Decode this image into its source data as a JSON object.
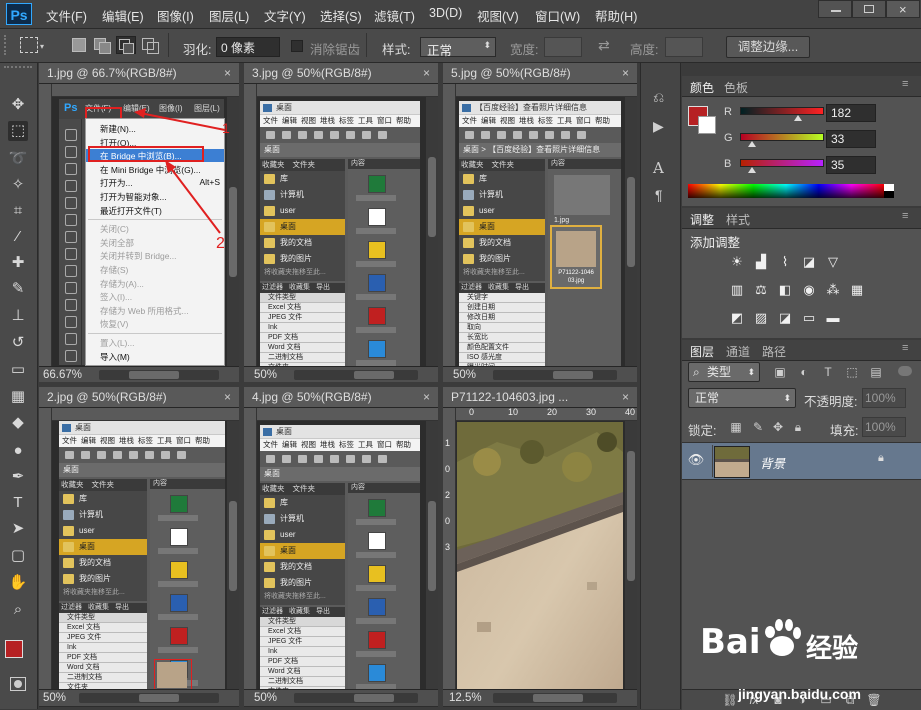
{
  "app": {
    "logo": "Ps"
  },
  "menu": [
    "文件(F)",
    "编辑(E)",
    "图像(I)",
    "图层(L)",
    "文字(Y)",
    "选择(S)",
    "滤镜(T)",
    "3D(D)",
    "视图(V)",
    "窗口(W)",
    "帮助(H)"
  ],
  "options": {
    "feather_label": "羽化:",
    "feather_value": "0 像素",
    "antialias_label": "消除锯齿",
    "style_label": "样式:",
    "style_value": "正常",
    "width_label": "宽度:",
    "height_label": "高度:",
    "refine_edge": "调整边缘..."
  },
  "docs": [
    {
      "title": "1.jpg @ 66.7%(RGB/8#)",
      "zoom": "66.67%"
    },
    {
      "title": "3.jpg @ 50%(RGB/8#)",
      "zoom": "50%"
    },
    {
      "title": "5.jpg @ 50%(RGB/8#)",
      "zoom": "50%"
    },
    {
      "title": "2.jpg @ 50%(RGB/8#)",
      "zoom": "50%"
    },
    {
      "title": "4.jpg @ 50%(RGB/8#)",
      "zoom": "50%"
    },
    {
      "title": "P71122-104603.jpg ...",
      "zoom": "12.5%"
    }
  ],
  "close_glyph": "×",
  "doc6_ruler": [
    "0",
    "10",
    "20",
    "30",
    "40"
  ],
  "doc6_vruler": [
    "1",
    "0",
    "2",
    "0",
    "3"
  ],
  "doc1": {
    "ps": "Ps",
    "mini_menu": [
      "文件(F)",
      "编辑(E)",
      "图像(I)",
      "图层(L)"
    ],
    "dropdown": [
      {
        "label": "新建(N)...",
        "dis": false
      },
      {
        "label": "打开(O)...",
        "dis": false
      },
      {
        "label": "在 Bridge 中浏览(B)...",
        "dis": false,
        "hl": true
      },
      {
        "label": "在 Mini Bridge 中浏览(G)...",
        "dis": false
      },
      {
        "label": "打开为...",
        "dis": false,
        "short": "Alt+S"
      },
      {
        "label": "打开为智能对象...",
        "dis": false
      },
      {
        "label": "最近打开文件(T)",
        "dis": false
      },
      {
        "label": "关闭(C)",
        "dis": true
      },
      {
        "label": "关闭全部",
        "dis": true
      },
      {
        "label": "关闭并转到 Bridge...",
        "dis": true
      },
      {
        "label": "存储(S)",
        "dis": true
      },
      {
        "label": "存储为(A)...",
        "dis": true
      },
      {
        "label": "签入(I)...",
        "dis": true
      },
      {
        "label": "存储为 Web 所用格式...",
        "dis": true
      },
      {
        "label": "恢复(V)",
        "dis": true
      },
      {
        "label": "置入(L)...",
        "dis": true
      },
      {
        "label": "导入(M)",
        "dis": false
      }
    ],
    "annot1": "1",
    "annot2": "2"
  },
  "bridge": {
    "title": "桌面",
    "title5": "【百度经验】查看照片详细信息",
    "menu": [
      "文件",
      "编辑",
      "视图",
      "堆栈",
      "标签",
      "工具",
      "窗口",
      "帮助"
    ],
    "path": "桌面",
    "path5": "桌面 > 【百度经验】查看照片详细信息",
    "fav_tabs": [
      "收藏夹",
      "文件夹"
    ],
    "fav": [
      "库",
      "计算机",
      "user",
      "桌面",
      "我的文档",
      "我的图片"
    ],
    "fav_hint": "将收藏夹拖移至此...",
    "filter_tabs": [
      "过滤器",
      "收藏集",
      "导出"
    ],
    "meta_head": "文件类型",
    "meta": [
      {
        "k": "Excel 文档",
        "v": "6"
      },
      {
        "k": "JPEG 文件",
        "v": "6"
      },
      {
        "k": "Ink",
        "v": "18"
      },
      {
        "k": "PDF 文档",
        "v": "4"
      },
      {
        "k": "Word 文档",
        "v": "6"
      },
      {
        "k": "二进制文档",
        "v": "1"
      },
      {
        "k": "文件夹",
        "v": "21"
      }
    ],
    "meta_foot": "关键字",
    "content_tab": "内容",
    "meta5": [
      "关键字",
      "创建日期",
      "修改日期",
      "取向",
      "长宽比",
      "颜色配置文件",
      "ISO 感光度",
      "曝光时间",
      "光圈值"
    ],
    "thumb5": "P71122-1046 03.jpg",
    "thumb5_name": "1.jpg",
    "thumb2_name": "P71122-1046"
  },
  "color_panel": {
    "tabs": [
      "颜色",
      "色板"
    ],
    "r_label": "R",
    "g_label": "G",
    "b_label": "B",
    "r": "182",
    "g": "33",
    "b": "35",
    "fg": "#b62123"
  },
  "adjust_panel": {
    "tabs": [
      "调整",
      "样式"
    ],
    "title": "添加调整"
  },
  "layers_panel": {
    "tabs": [
      "图层",
      "通道",
      "路径"
    ],
    "kind": "类型",
    "blend": "正常",
    "opacity_label": "不透明度:",
    "opacity": "100%",
    "lock_label": "锁定:",
    "fill_label": "填充:",
    "fill": "100%",
    "layer_name": "背景"
  },
  "watermark": {
    "brand": "Bai",
    "cn": "经验",
    "url": "jingyan.baidu.com"
  }
}
